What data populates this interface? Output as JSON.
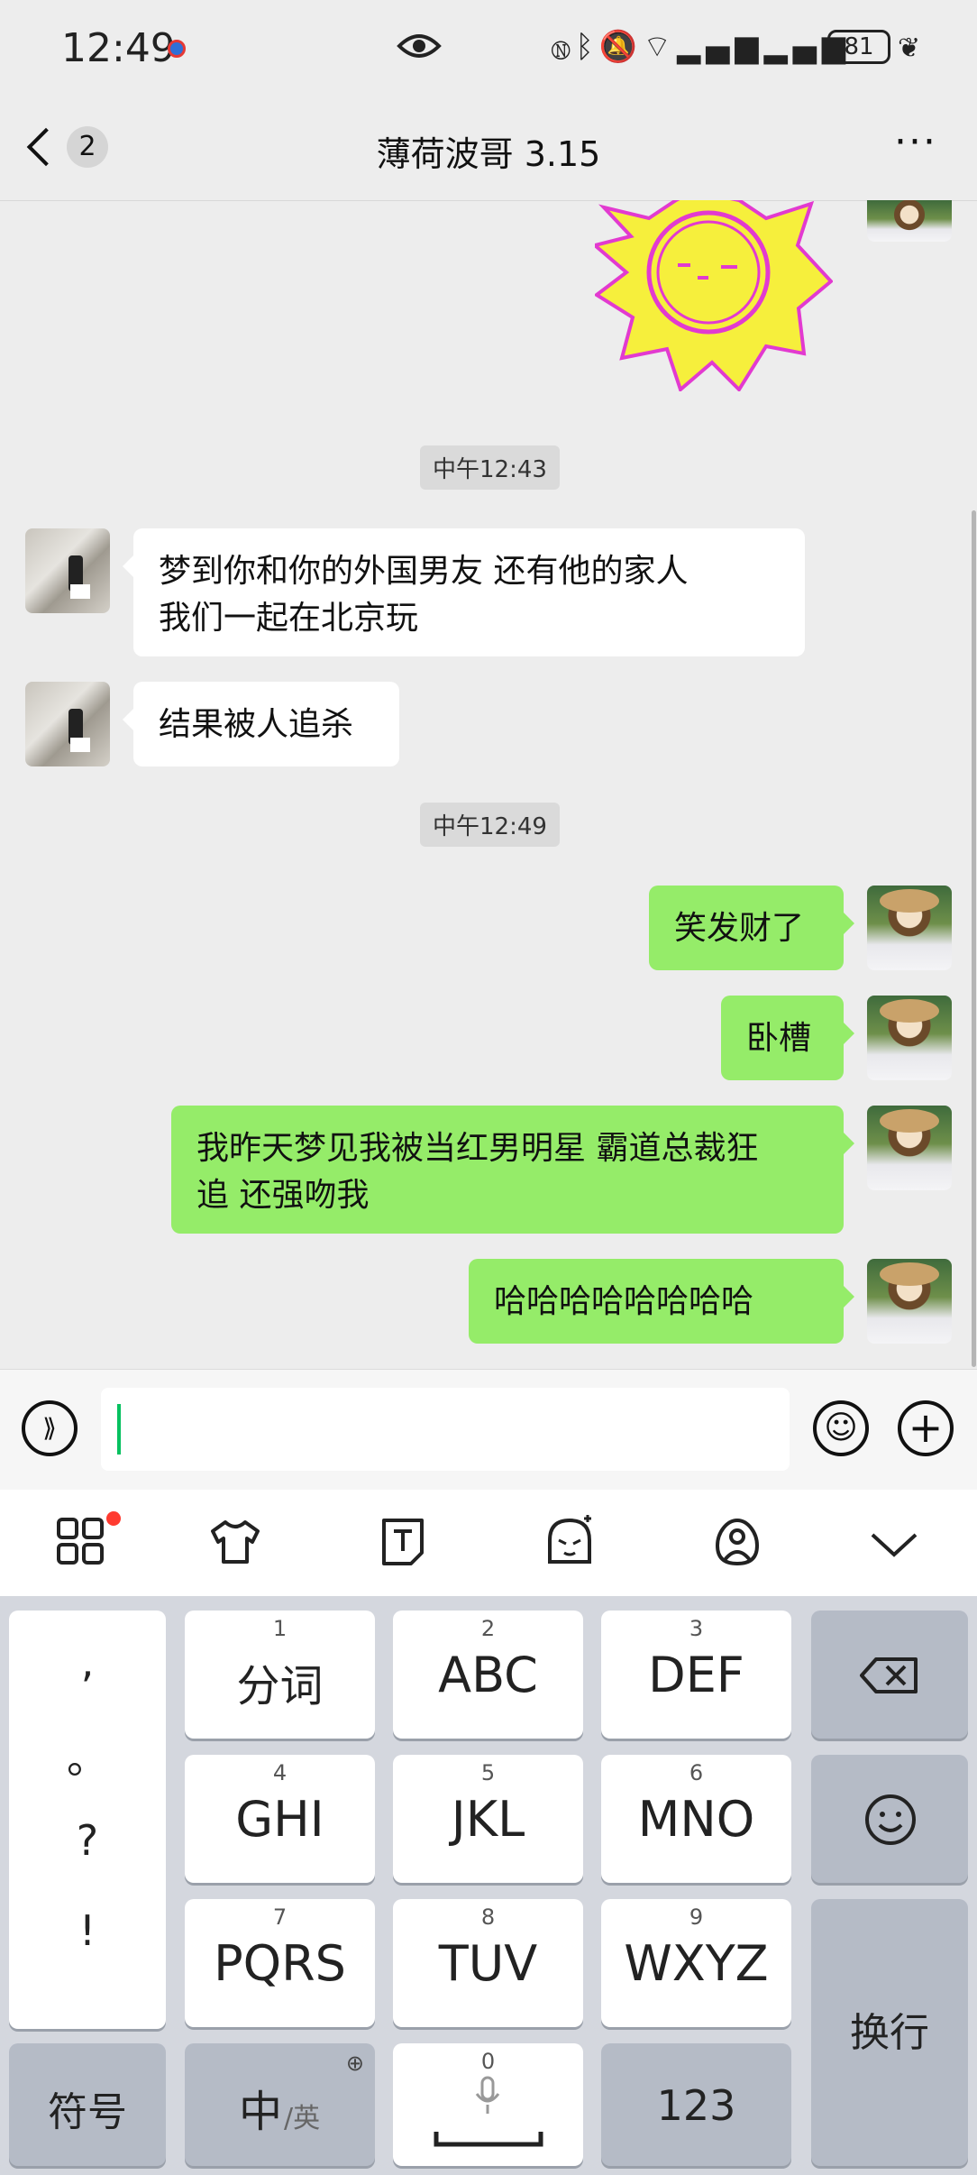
{
  "status_bar": {
    "time": "12:49",
    "battery": "81",
    "icons": [
      "eye-icon",
      "nfc-icon",
      "bluetooth-icon",
      "mute-icon",
      "wifi-icon",
      "signal-icon",
      "signal-icon",
      "battery-icon",
      "leaf-icon"
    ]
  },
  "header": {
    "back_count": "2",
    "title": "薄荷波哥 3.15"
  },
  "messages": {
    "ts1": "中午12:43",
    "m1": "梦到你和你的外国男友  还有他的家人\n我们一起在北京玩",
    "m2": "结果被人追杀",
    "ts2": "中午12:49",
    "m3": "笑发财了",
    "m4": "卧槽",
    "m5": "我昨天梦见我被当红男明星 霸道总裁狂\n追 还强吻我",
    "m6": "哈哈哈哈哈哈哈哈"
  },
  "keyboard": {
    "punct": [
      ",",
      "。",
      "?",
      "!"
    ],
    "keys": [
      {
        "num": "1",
        "label": "分词"
      },
      {
        "num": "2",
        "label": "ABC"
      },
      {
        "num": "3",
        "label": "DEF"
      },
      {
        "num": "4",
        "label": "GHI"
      },
      {
        "num": "5",
        "label": "JKL"
      },
      {
        "num": "6",
        "label": "MNO"
      },
      {
        "num": "7",
        "label": "PQRS"
      },
      {
        "num": "8",
        "label": "TUV"
      },
      {
        "num": "9",
        "label": "WXYZ"
      }
    ],
    "symbol": "符号",
    "zh": "中",
    "en": "/英",
    "space_num": "0",
    "num123": "123",
    "enter": "换行"
  },
  "colors": {
    "green_bubble": "#95ec69",
    "accent": "#07c160",
    "background": "#ededed"
  }
}
